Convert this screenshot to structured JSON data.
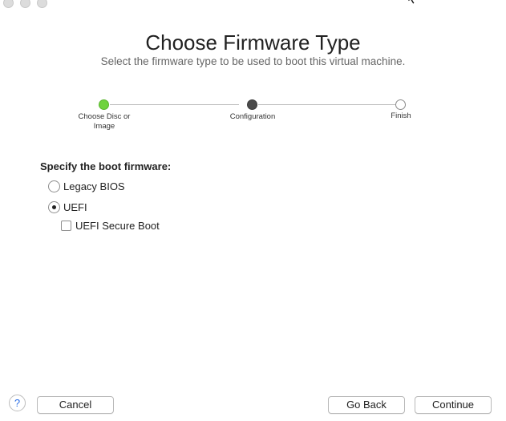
{
  "header": {
    "title": "Choose Firmware Type",
    "subtitle": "Select the firmware type to be used to boot this virtual machine."
  },
  "steps": [
    {
      "label": "Choose Disc or Image",
      "state": "done"
    },
    {
      "label": "Configuration",
      "state": "current"
    },
    {
      "label": "Finish",
      "state": "todo"
    }
  ],
  "colors": {
    "done": "#6fd33d",
    "current": "#4a4a4a",
    "accent": "#2a6ee6"
  },
  "firmware": {
    "section_label": "Specify the boot firmware:",
    "options": [
      {
        "label": "Legacy BIOS",
        "selected": false
      },
      {
        "label": "UEFI",
        "selected": true
      }
    ],
    "secure_boot": {
      "label": "UEFI Secure Boot",
      "checked": false
    }
  },
  "footer": {
    "help_label": "?",
    "cancel_label": "Cancel",
    "back_label": "Go Back",
    "continue_label": "Continue"
  }
}
